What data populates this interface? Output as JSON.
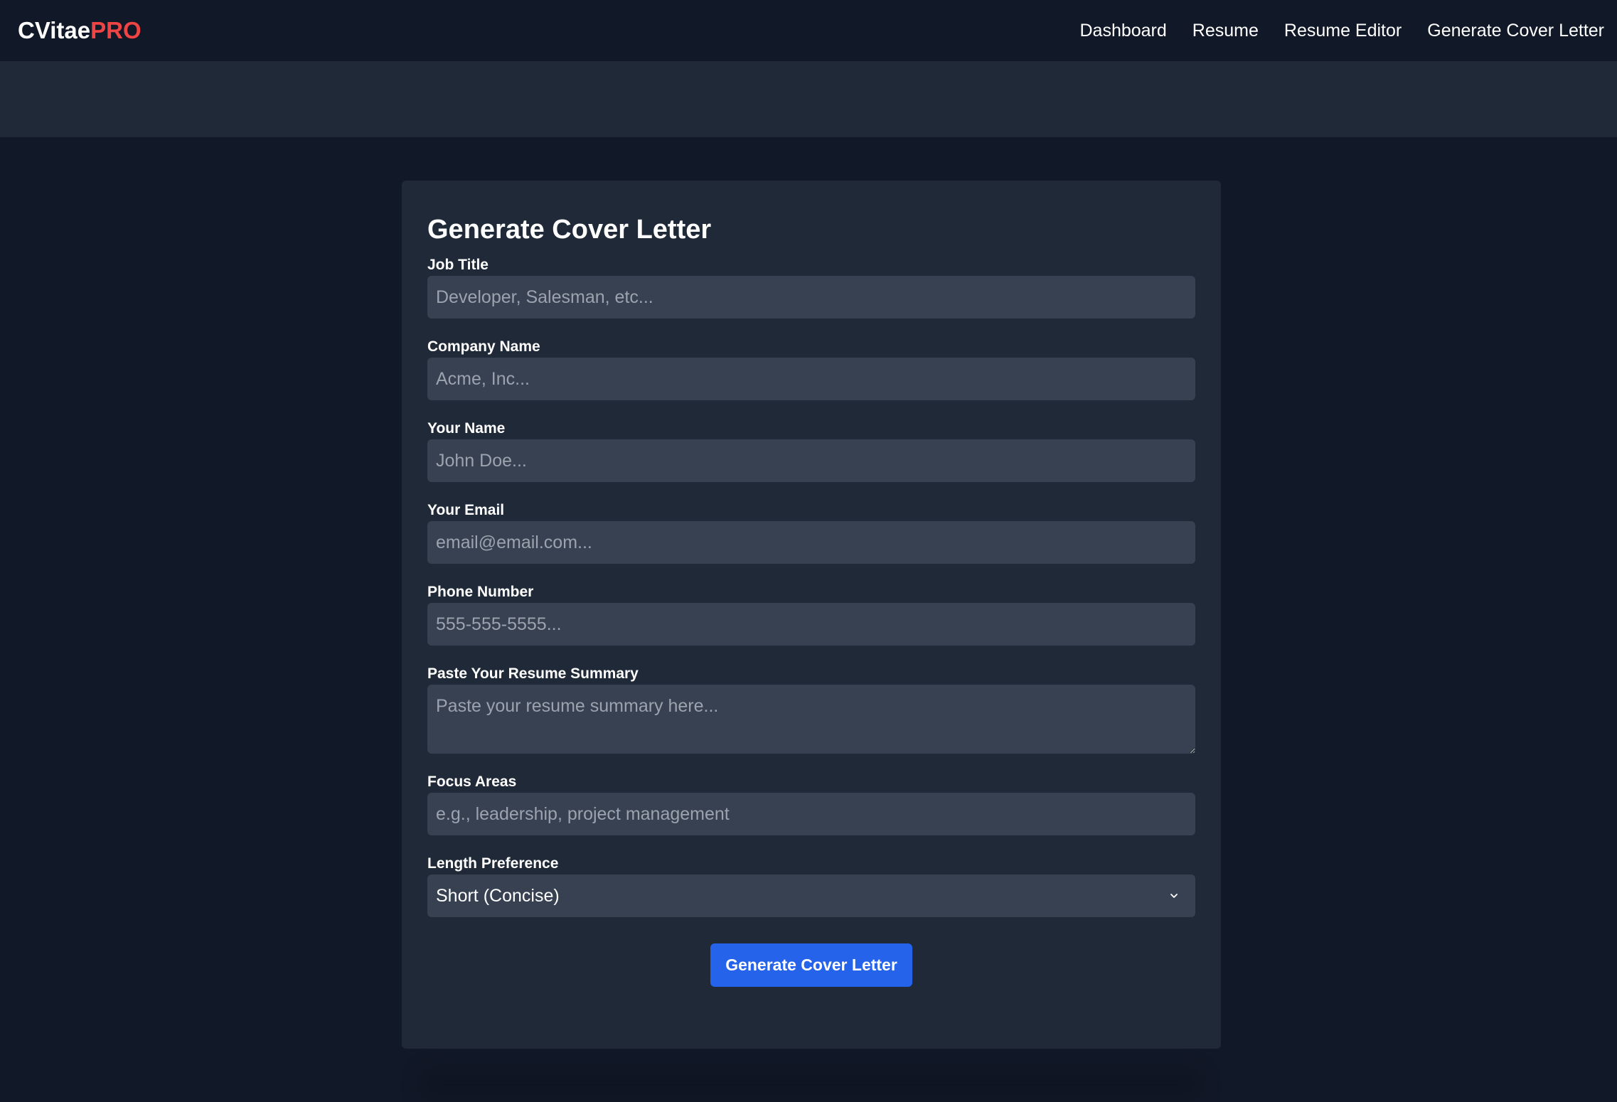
{
  "brand": {
    "main": "CVitae",
    "accent": "PRO"
  },
  "nav": {
    "items": [
      {
        "label": "Dashboard"
      },
      {
        "label": "Resume"
      },
      {
        "label": "Resume Editor"
      },
      {
        "label": "Generate Cover Letter"
      }
    ]
  },
  "form": {
    "title": "Generate Cover Letter",
    "job_title": {
      "label": "Job Title",
      "placeholder": "Developer, Salesman, etc...",
      "value": ""
    },
    "company_name": {
      "label": "Company Name",
      "placeholder": "Acme, Inc...",
      "value": ""
    },
    "your_name": {
      "label": "Your Name",
      "placeholder": "John Doe...",
      "value": ""
    },
    "your_email": {
      "label": "Your Email",
      "placeholder": "email@email.com...",
      "value": ""
    },
    "phone_number": {
      "label": "Phone Number",
      "placeholder": "555-555-5555...",
      "value": ""
    },
    "resume_summary": {
      "label": "Paste Your Resume Summary",
      "placeholder": "Paste your resume summary here...",
      "value": ""
    },
    "focus_areas": {
      "label": "Focus Areas",
      "placeholder": "e.g., leadership, project management",
      "value": ""
    },
    "length_preference": {
      "label": "Length Preference",
      "selected": "Short (Concise)",
      "icon": "chevron-down-icon"
    },
    "submit_label": "Generate Cover Letter"
  },
  "colors": {
    "background": "#111827",
    "card": "#1f2937",
    "input": "#374151",
    "accent": "#ef4444",
    "button": "#2563eb"
  }
}
